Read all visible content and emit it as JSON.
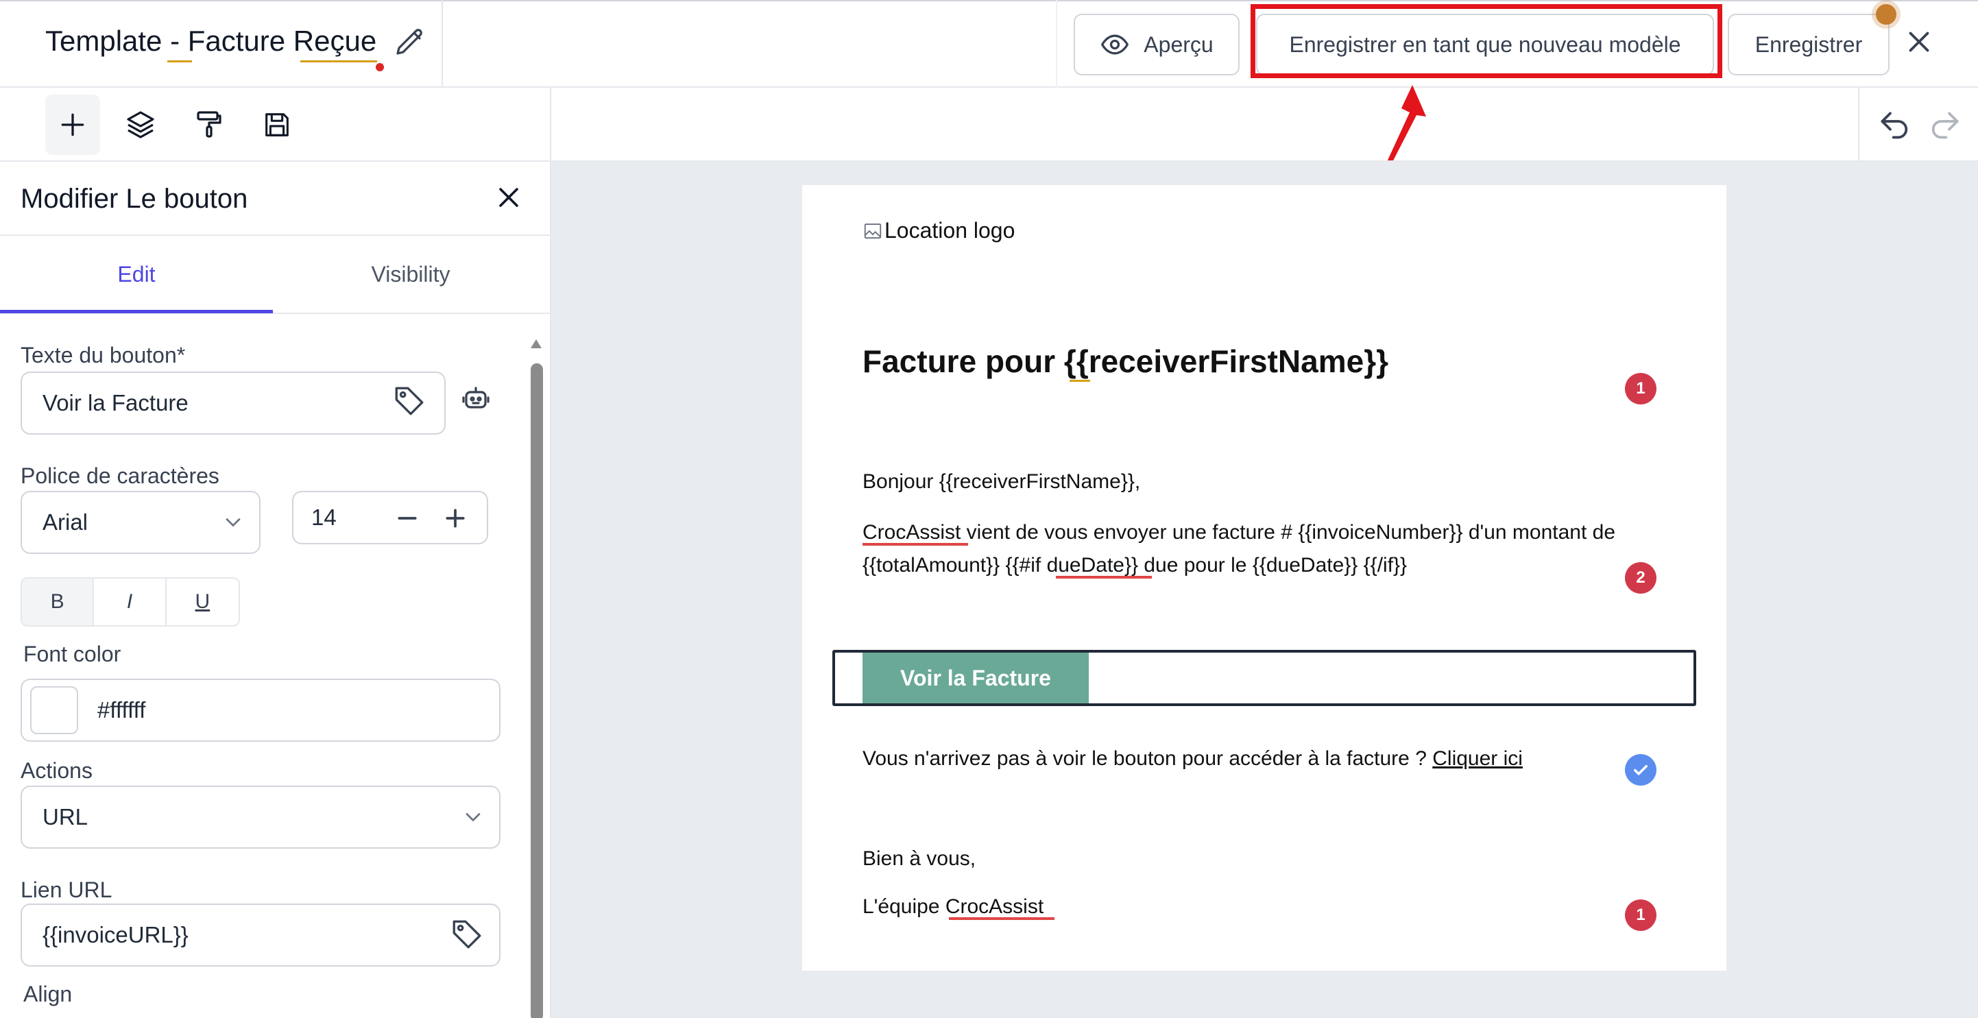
{
  "header": {
    "title": "Template - Facture Reçue",
    "preview_label": "Aperçu",
    "save_as_new_label": "Enregistrer en tant que nouveau modèle",
    "save_label": "Enregistrer"
  },
  "panel": {
    "title": "Modifier Le bouton",
    "tabs": [
      {
        "label": "Edit",
        "active": true
      },
      {
        "label": "Visibility",
        "active": false
      }
    ],
    "button_text_label": "Texte du bouton*",
    "button_text_value": "Voir la Facture",
    "font_label": "Police de caractères",
    "font_value": "Arial",
    "font_size_value": "14",
    "style_buttons": [
      "B",
      "I",
      "U"
    ],
    "font_color_label": "Font color",
    "font_color_value": "#ffffff",
    "actions_label": "Actions",
    "actions_value": "URL",
    "url_label": "Lien URL",
    "url_value": "{{invoiceURL}}",
    "align_label": "Align"
  },
  "email": {
    "logo_alt": "Location logo",
    "heading": "Facture pour {{receiverFirstName}}",
    "greeting": "Bonjour {{receiverFirstName}},",
    "body_line1": "CrocAssist vient de vous envoyer une facture # {{invoiceNumber}} d'un montant de",
    "body_line2": "{{totalAmount}} {{#if dueDate}} due pour le {{dueDate}} {{/if}}",
    "cta_label": "Voir la Facture",
    "fallback_text": "Vous n'arrivez pas à voir le bouton pour accéder à la facture ?",
    "fallback_link": "Cliquer ici",
    "signoff": "Bien à vous,",
    "signature": "L'équipe CrocAssist",
    "badges": [
      "1",
      "2",
      "",
      "1"
    ]
  },
  "colors": {
    "accent": "#4f46e5",
    "highlight": "#e3141b",
    "cta_background": "#6aa997",
    "badge_error": "#d1394b",
    "badge_ok": "#5b8def"
  },
  "icons": [
    "pencil-icon",
    "eye-icon",
    "close-icon",
    "plus-icon",
    "layers-icon",
    "paint-roller-icon",
    "floppy-disk-icon",
    "undo-icon",
    "redo-icon",
    "tag-icon",
    "robot-icon",
    "chevron-down-icon",
    "minus-icon",
    "image-icon",
    "check-icon"
  ]
}
